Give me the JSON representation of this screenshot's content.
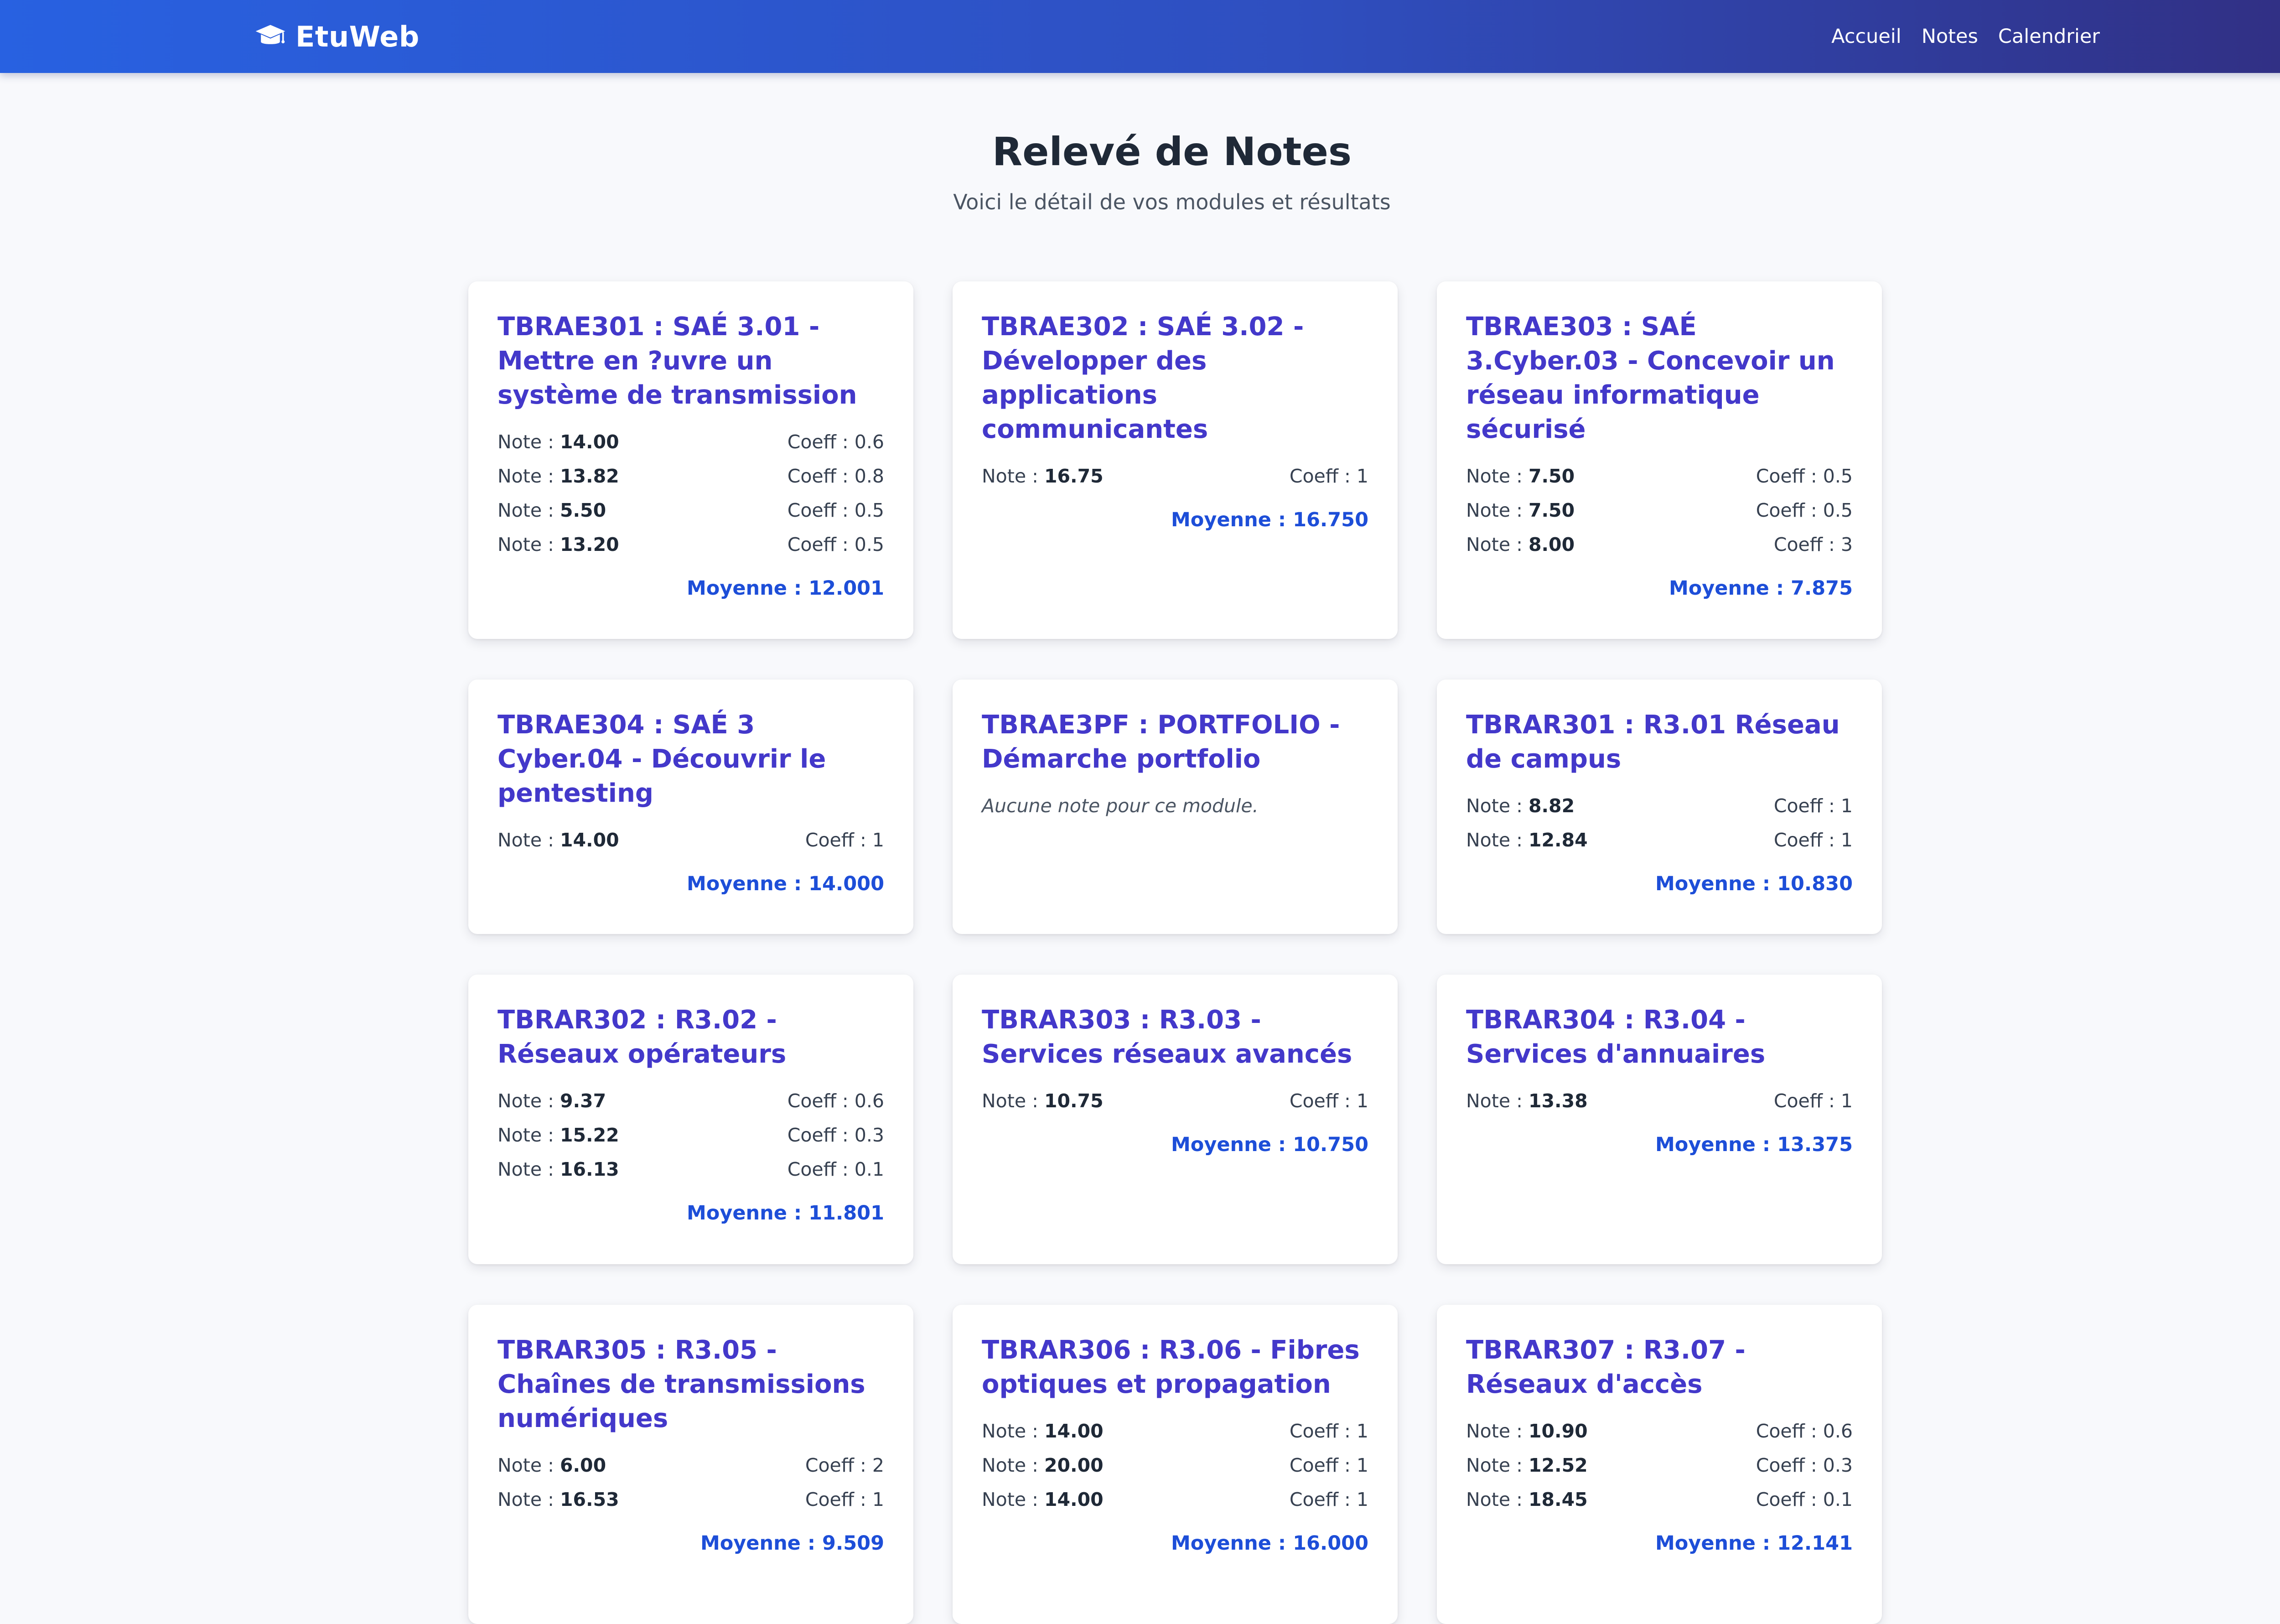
{
  "header": {
    "brand": "EtuWeb",
    "brand_icon": "graduation-cap-icon",
    "nav": [
      "Accueil",
      "Notes",
      "Calendrier"
    ],
    "gradient": [
      "#2861e1",
      "#312e81"
    ]
  },
  "page": {
    "title": "Relevé de Notes",
    "subtitle": "Voici le détail de vos modules et résultats"
  },
  "labels": {
    "note": "Note : ",
    "coeff": "Coeff : ",
    "empty": "Aucune note pour ce module."
  },
  "colors": {
    "title": "#4338ca",
    "average": "#1d4ed8",
    "background": "#f8f9fc"
  },
  "modules": [
    {
      "title": "TBRAE301 : SAÉ 3.01 - Mettre en ?uvre un système de transmission",
      "grades": [
        {
          "note": "14.00",
          "coeff": "0.6"
        },
        {
          "note": "13.82",
          "coeff": "0.8"
        },
        {
          "note": "5.50",
          "coeff": "0.5"
        },
        {
          "note": "13.20",
          "coeff": "0.5"
        }
      ],
      "average": "Moyenne : 12.001"
    },
    {
      "title": "TBRAE302 : SAÉ 3.02 - Développer des applications communicantes",
      "grades": [
        {
          "note": "16.75",
          "coeff": "1"
        }
      ],
      "average": "Moyenne : 16.750"
    },
    {
      "title": "TBRAE303 : SAÉ 3.Cyber.03 - Concevoir un réseau informatique sécurisé",
      "grades": [
        {
          "note": "7.50",
          "coeff": "0.5"
        },
        {
          "note": "7.50",
          "coeff": "0.5"
        },
        {
          "note": "8.00",
          "coeff": "3"
        }
      ],
      "average": "Moyenne : 7.875"
    },
    {
      "title": "TBRAE304 : SAÉ 3 Cyber.04 - Découvrir le pentesting",
      "grades": [
        {
          "note": "14.00",
          "coeff": "1"
        }
      ],
      "average": "Moyenne : 14.000"
    },
    {
      "title": "TBRAE3PF : PORTFOLIO - Démarche portfolio",
      "grades": [],
      "average": ""
    },
    {
      "title": "TBRAR301 : R3.01 Réseau de campus",
      "grades": [
        {
          "note": "8.82",
          "coeff": "1"
        },
        {
          "note": "12.84",
          "coeff": "1"
        }
      ],
      "average": "Moyenne : 10.830"
    },
    {
      "title": "TBRAR302 : R3.02 - Réseaux opérateurs",
      "grades": [
        {
          "note": "9.37",
          "coeff": "0.6"
        },
        {
          "note": "15.22",
          "coeff": "0.3"
        },
        {
          "note": "16.13",
          "coeff": "0.1"
        }
      ],
      "average": "Moyenne : 11.801"
    },
    {
      "title": "TBRAR303 : R3.03 - Services réseaux avancés",
      "grades": [
        {
          "note": "10.75",
          "coeff": "1"
        }
      ],
      "average": "Moyenne : 10.750"
    },
    {
      "title": "TBRAR304 : R3.04 - Services d'annuaires",
      "grades": [
        {
          "note": "13.38",
          "coeff": "1"
        }
      ],
      "average": "Moyenne : 13.375"
    },
    {
      "title": "TBRAR305 : R3.05 - Chaînes de transmissions numériques",
      "grades": [
        {
          "note": "6.00",
          "coeff": "2"
        },
        {
          "note": "16.53",
          "coeff": "1"
        }
      ],
      "average": "Moyenne : 9.509"
    },
    {
      "title": "TBRAR306 : R3.06 - Fibres optiques et propagation",
      "grades": [
        {
          "note": "14.00",
          "coeff": "1"
        },
        {
          "note": "20.00",
          "coeff": "1"
        },
        {
          "note": "14.00",
          "coeff": "1"
        }
      ],
      "average": "Moyenne : 16.000"
    },
    {
      "title": "TBRAR307 : R3.07 - Réseaux d'accès",
      "grades": [
        {
          "note": "10.90",
          "coeff": "0.6"
        },
        {
          "note": "12.52",
          "coeff": "0.3"
        },
        {
          "note": "18.45",
          "coeff": "0.1"
        }
      ],
      "average": "Moyenne : 12.141"
    }
  ]
}
